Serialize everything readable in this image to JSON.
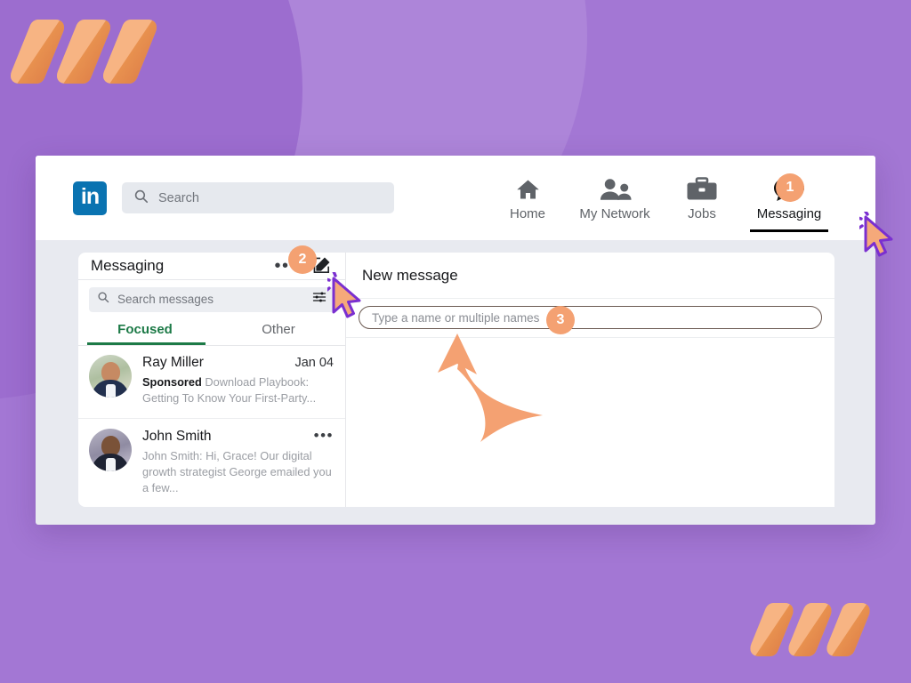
{
  "theme": {
    "background_purple": "#a377d4",
    "accent_orange": "#f4a172",
    "linkedin_blue": "#0a73b1",
    "focused_green": "#1d7a47",
    "card_background": "#e8eaf0"
  },
  "topbar": {
    "logo_text": "in",
    "search": {
      "icon": "search-icon",
      "placeholder": "Search",
      "value": ""
    },
    "nav_items": [
      {
        "label": "Home",
        "icon": "home-icon",
        "active": false
      },
      {
        "label": "My Network",
        "icon": "people-icon",
        "active": false
      },
      {
        "label": "Jobs",
        "icon": "briefcase-icon",
        "active": false
      },
      {
        "label": "Messaging",
        "icon": "message-bubble-icon",
        "active": true
      }
    ]
  },
  "messaging_panel": {
    "title": "Messaging",
    "overflow_icon": "ellipsis-icon",
    "compose_icon": "compose-pencil-icon",
    "search": {
      "icon": "search-icon",
      "placeholder": "Search messages",
      "value": "",
      "filter_icon": "filter-sliders-icon"
    },
    "tabs": [
      {
        "label": "Focused",
        "active": true
      },
      {
        "label": "Other",
        "active": false
      }
    ],
    "conversations": [
      {
        "name": "Ray Miller",
        "date": "Jan 04",
        "preview_label": "Sponsored",
        "preview": "Download Playbook: Getting To Know Your First-Party...",
        "avatar": "avatar-ray-miller",
        "has_overflow": false
      },
      {
        "name": "John Smith",
        "date": "",
        "preview_label": "",
        "preview": "John Smith: Hi, Grace! Our digital growth strategist George emailed you a few...",
        "avatar": "avatar-john-smith",
        "has_overflow": true,
        "overflow_icon": "ellipsis-icon"
      }
    ]
  },
  "new_message_panel": {
    "title": "New message",
    "recipient_input": {
      "placeholder": "Type a name or multiple names",
      "value": ""
    }
  },
  "annotations": {
    "badges": [
      {
        "number": "1",
        "target": "messaging-nav-item"
      },
      {
        "number": "2",
        "target": "compose-button"
      },
      {
        "number": "3",
        "target": "recipient-input"
      }
    ],
    "cursors": [
      {
        "name": "cursor-messaging"
      },
      {
        "name": "cursor-compose"
      }
    ],
    "arrow": {
      "name": "curved-arrow-to-recipient-input"
    }
  },
  "decorations": {
    "brand_mark_top_left": "three-slashes-logo",
    "brand_mark_bottom_right": "three-slashes-logo"
  }
}
